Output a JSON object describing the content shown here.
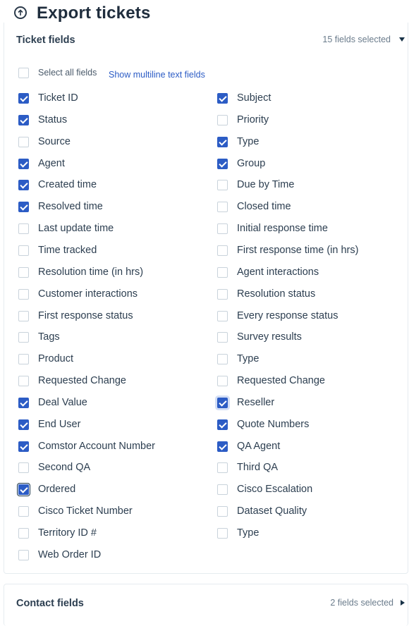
{
  "header": {
    "title": "Export tickets"
  },
  "ticket_section": {
    "title": "Ticket fields",
    "count": "15 fields selected",
    "select_all": "Select all fields",
    "multiline_link": "Show multiline text fields",
    "left": [
      {
        "label": "Ticket ID",
        "checked": true
      },
      {
        "label": "Status",
        "checked": true
      },
      {
        "label": "Source",
        "checked": false
      },
      {
        "label": "Agent",
        "checked": true
      },
      {
        "label": "Created time",
        "checked": true
      },
      {
        "label": "Resolved time",
        "checked": true
      },
      {
        "label": "Last update time",
        "checked": false
      },
      {
        "label": "Time tracked",
        "checked": false
      },
      {
        "label": "Resolution time (in hrs)",
        "checked": false
      },
      {
        "label": "Customer interactions",
        "checked": false
      },
      {
        "label": "First response status",
        "checked": false
      },
      {
        "label": "Tags",
        "checked": false
      },
      {
        "label": "Product",
        "checked": false
      },
      {
        "label": "Requested Change",
        "checked": false
      },
      {
        "label": "Deal Value",
        "checked": true
      },
      {
        "label": "End User",
        "checked": true
      },
      {
        "label": "Comstor Account Number",
        "checked": true
      },
      {
        "label": "Second QA",
        "checked": false
      },
      {
        "label": "Ordered",
        "checked": true
      },
      {
        "label": "Cisco Ticket Number",
        "checked": false
      },
      {
        "label": "Territory ID #",
        "checked": false
      },
      {
        "label": "Web Order ID",
        "checked": false
      }
    ],
    "right": [
      {
        "label": "Subject",
        "checked": true
      },
      {
        "label": "Priority",
        "checked": false
      },
      {
        "label": "Type",
        "checked": true
      },
      {
        "label": "Group",
        "checked": true
      },
      {
        "label": "Due by Time",
        "checked": false
      },
      {
        "label": "Closed time",
        "checked": false
      },
      {
        "label": "Initial response time",
        "checked": false
      },
      {
        "label": "First response time (in hrs)",
        "checked": false
      },
      {
        "label": "Agent interactions",
        "checked": false
      },
      {
        "label": "Resolution status",
        "checked": false
      },
      {
        "label": "Every response status",
        "checked": false
      },
      {
        "label": "Survey results",
        "checked": false
      },
      {
        "label": "Type",
        "checked": false
      },
      {
        "label": "Requested Change",
        "checked": false
      },
      {
        "label": "Reseller",
        "checked": true
      },
      {
        "label": "Quote Numbers",
        "checked": true
      },
      {
        "label": "QA Agent",
        "checked": true
      },
      {
        "label": "Third QA",
        "checked": false
      },
      {
        "label": "Cisco Escalation",
        "checked": false
      },
      {
        "label": "Dataset Quality",
        "checked": false
      },
      {
        "label": "Type",
        "checked": false
      }
    ]
  },
  "contact_section": {
    "title": "Contact fields",
    "count": "2 fields selected"
  }
}
